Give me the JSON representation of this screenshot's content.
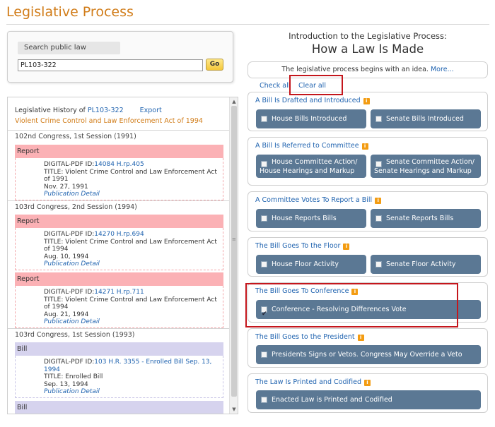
{
  "page": {
    "title": "Legislative Process"
  },
  "search": {
    "label": "Search public law",
    "value": "PL103-322",
    "go_label": "Go"
  },
  "history": {
    "prefix": "Legislative History of ",
    "law_link": "PL103-322",
    "export_label": "Export",
    "act_title": "Violent Crime Control and Law Enforcement Act of 1994",
    "sections": [
      {
        "congress": "102nd Congress, 1st Session (1991)"
      },
      {
        "congress": "103rd Congress, 2nd Session (1994)"
      },
      {
        "congress": "103rd Congress, 1st Session (1993)"
      }
    ],
    "entries": [
      {
        "type": "Report",
        "id_prefix": "DIGITAL-PDF ID:",
        "id": "14084 H.rp.405",
        "title": "TITLE: Violent Crime Control and Law Enforcement Act of 1991",
        "date": "Nov. 27, 1991",
        "detail_link": "Publication Detail"
      },
      {
        "type": "Report",
        "id_prefix": "DIGITAL-PDF ID:",
        "id": "14270 H.rp.694",
        "title": "TITLE: Violent Crime Control and Law Enforcement Act of 1994",
        "date": "Aug. 10, 1994",
        "detail_link": "Publication Detail"
      },
      {
        "type": "Report",
        "id_prefix": "DIGITAL-PDF ID:",
        "id": "14271 H.rp.711",
        "title": "TITLE: Violent Crime Control and Law Enforcement Act of 1994",
        "date": "Aug. 21, 1994",
        "detail_link": "Publication Detail"
      },
      {
        "type": "Bill",
        "id_prefix": "DIGITAL-PDF ID:",
        "id": "103 H.R. 3355 - Enrolled Bill Sep. 13, 1994",
        "title": "TITLE: Enrolled Bill",
        "date": "Sep. 13, 1994",
        "detail_link": "Publication Detail"
      },
      {
        "type": "Bill"
      }
    ]
  },
  "intro": {
    "subtitle": "Introduction to the Legislative Process:",
    "title": "How a Law Is Made",
    "idea_text": "The legislative process begins with an idea.",
    "more_link": "More..."
  },
  "controls": {
    "check_all": "Check all",
    "clear_all": "Clear all"
  },
  "steps": [
    {
      "title": "A Bill Is Drafted and Introduced",
      "buttons": [
        {
          "label": "House Bills Introduced",
          "checked": false
        },
        {
          "label": "Senate Bills Introduced",
          "checked": false
        }
      ]
    },
    {
      "title": "A Bill Is Referred to Committee",
      "buttons": [
        {
          "label_line1": "House Committee Action/",
          "label_line2": "House Hearings and Markup",
          "checked": false
        },
        {
          "label_line1": "Senate Committee Action/",
          "label_line2": "Senate Hearings and Markup",
          "checked": false
        }
      ]
    },
    {
      "title": "A Committee Votes To Report a Bill",
      "buttons": [
        {
          "label": "House Reports Bills",
          "checked": false
        },
        {
          "label": "Senate Reports Bills",
          "checked": false
        }
      ]
    },
    {
      "title": "The Bill Goes To the Floor",
      "buttons": [
        {
          "label": "House Floor Activity",
          "checked": false
        },
        {
          "label": "Senate Floor Activity",
          "checked": false
        }
      ]
    },
    {
      "title": "The Bill Goes To Conference",
      "buttons": [
        {
          "label": "Conference - Resolving Differences Vote",
          "checked": true
        }
      ]
    },
    {
      "title": "The Bill Goes to the President",
      "buttons": [
        {
          "label": "Presidents Signs or Vetos. Congress May Override a Veto",
          "checked": false
        }
      ]
    },
    {
      "title": "The Law Is Printed and Codified",
      "buttons": [
        {
          "label": "Enacted Law is Printed and Codified",
          "checked": false
        }
      ]
    }
  ],
  "icons": {
    "info": "info-icon",
    "scroll_up": "scroll-up-arrow-icon",
    "scroll_down": "scroll-down-arrow-icon"
  },
  "colors": {
    "title_orange": "#d17d1a",
    "link_blue": "#2164b0",
    "button_slate": "#5b7894",
    "report_pink": "#fbb1b5",
    "bill_lavender": "#d6d3ee",
    "highlight_red": "#c4161c"
  }
}
